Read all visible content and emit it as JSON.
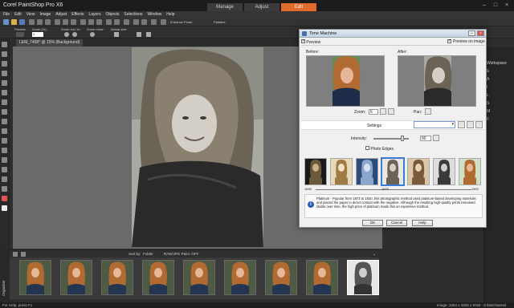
{
  "app": {
    "title": "Corel PaintShop Pro X6",
    "mode_tabs": [
      "Manage",
      "Adjust",
      "Edit"
    ],
    "active_mode": "Edit",
    "accent_color": "#e36b2a"
  },
  "menu": [
    "File",
    "Edit",
    "View",
    "Image",
    "Adjust",
    "Effects",
    "Layers",
    "Objects",
    "Selections",
    "Window",
    "Help"
  ],
  "toolbar2": {
    "presets_label": "Presets:",
    "zoom_label": "Zoom (%):",
    "zoom_value": "1",
    "zoom_outin_label": "Zoom out / in:",
    "zoom_more_label": "Zoom more:",
    "actual_size_label": "Actual size:",
    "enhance_photo": "Enhance Photo",
    "palettes": "Palettes"
  },
  "document": {
    "tab_label": "LEM_7458* @ 15% (Background)"
  },
  "right_panel": {
    "heading": "Workspace",
    "tab_letters": [
      "E",
      "A",
      "i",
      "L",
      "S",
      "M",
      "F"
    ]
  },
  "organizer": {
    "side_label": "Organizer",
    "sort_label": "Sort by:",
    "sort_value": "Folder",
    "filter_label": "RAW/JPG Pairs: OFF",
    "thumb_count": 9,
    "selected_index": 8
  },
  "status": {
    "left": "For Help, press F1",
    "right": "Image: 3264 x 4928 x RGB - 8 bits/channel"
  },
  "dialog": {
    "title": "Time Machine",
    "preview_label": "Preview",
    "preview_on_image": "Preview on image",
    "preview_on_image_checked": true,
    "preview_checked": true,
    "before_label": "Before:",
    "after_label": "After:",
    "zoom_label": "Zoom:",
    "zoom_value": "6",
    "pan_label": "Pan:",
    "settings_label": "Settings",
    "intensity_label": "Intensity:",
    "intensity_value": "90",
    "photo_edges_label": "Photo Edges",
    "photo_edges_checked": false,
    "era_count": 7,
    "selected_era": 3,
    "scale_ticks": [
      "1839",
      "1875",
      "1900"
    ],
    "info_text": "Platinum - Popular from 1873 to 1920, this photographic method used platinum-based developing materials and placed the paper in direct contact with the negative. Although the resulting high-quality prints remained stable over time, the high price of platinum made this an expensive method.",
    "buttons": {
      "ok": "OK",
      "cancel": "Cancel",
      "help": "Help"
    }
  }
}
